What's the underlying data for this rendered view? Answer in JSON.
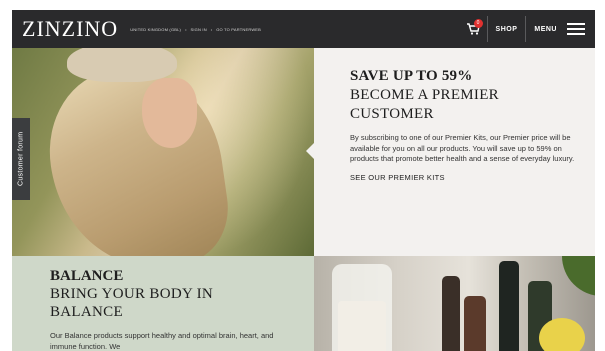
{
  "header": {
    "logo": "ZINZINO",
    "links": [
      "UNITED KINGDOM (GBL)",
      "SIGN IN",
      "GO TO PARTNERWEB"
    ],
    "link_separator": "•",
    "cart_badge": "0",
    "shop_label": "SHOP",
    "menu_label": "MENU"
  },
  "side_tab": {
    "label": "Customer forum"
  },
  "hero": {
    "headline": "SAVE UP TO 59%",
    "subheadline_line1": "BECOME A PREMIER",
    "subheadline_line2": "CUSTOMER",
    "body": "By subscribing to one of our Premier Kits, our Premier price will be available for you on all our products. You will save up to 59% on products that promote better health and a sense of everyday luxury.",
    "cta": "SEE OUR PREMIER KITS"
  },
  "balance": {
    "title": "BALANCE",
    "subtitle_line1": "BRING YOUR BODY IN",
    "subtitle_line2": "BALANCE",
    "body": "Our Balance products support healthy and optimal brain, heart, and immune function. We"
  },
  "colors": {
    "topbar": "#2a2a2c",
    "hero_panel": "#f3f1ef",
    "balance_panel": "#cfd8c9",
    "badge": "#e0312f"
  },
  "icons": {
    "cart": "cart-icon",
    "menu": "hamburger-icon"
  }
}
